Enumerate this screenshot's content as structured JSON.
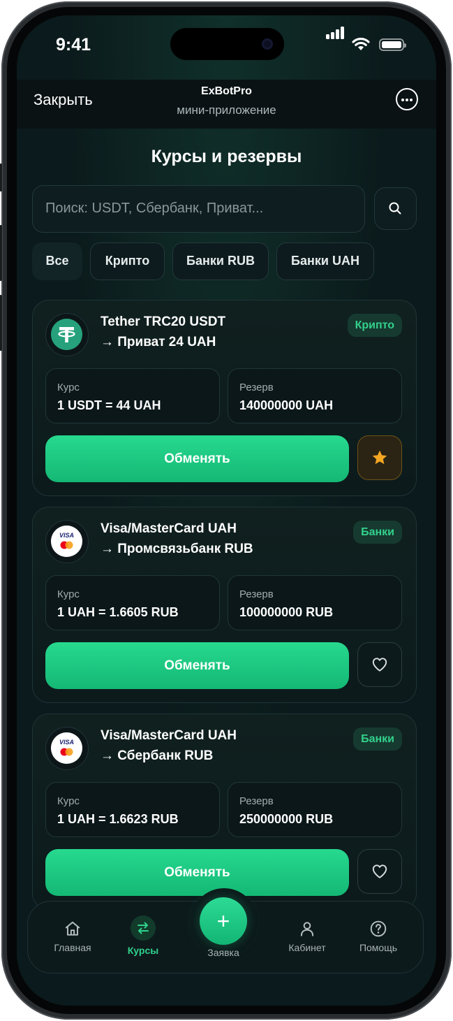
{
  "status_bar": {
    "time": "9:41"
  },
  "header": {
    "close_label": "Закрыть",
    "title": "ExBotPro",
    "subtitle": "мини-приложение"
  },
  "page_title": "Курсы и резервы",
  "search": {
    "placeholder": "Поиск: USDT, Сбербанк, Приват..."
  },
  "filters": [
    {
      "label": "Все",
      "active": true
    },
    {
      "label": "Крипто",
      "active": false
    },
    {
      "label": "Банки RUB",
      "active": false
    },
    {
      "label": "Банки UAH",
      "active": false
    }
  ],
  "cards": [
    {
      "from": "Tether TRC20 USDT",
      "to": "→ Приват 24 UAH",
      "tag": "Крипто",
      "rate_label": "Курс",
      "rate": "1 USDT = 44 UAH",
      "reserve_label": "Резерв",
      "reserve": "140000000 UAH",
      "button": "Обменять",
      "favorite": true,
      "logo": "tether-icon"
    },
    {
      "from": "Visa/MasterCard UAH",
      "to": "→ Промсвязьбанк RUB",
      "tag": "Банки",
      "rate_label": "Курс",
      "rate": "1 UAH = 1.6605 RUB",
      "reserve_label": "Резерв",
      "reserve": "100000000 RUB",
      "button": "Обменять",
      "favorite": false,
      "logo": "visa-mastercard-icon"
    },
    {
      "from": "Visa/MasterCard UAH",
      "to": "→ Сбербанк RUB",
      "tag": "Банки",
      "rate_label": "Курс",
      "rate": "1 UAH = 1.6623 RUB",
      "reserve_label": "Резерв",
      "reserve": "250000000 RUB",
      "button": "Обменять",
      "favorite": false,
      "logo": "visa-mastercard-icon"
    }
  ],
  "logo_text": {
    "visa": "VISA"
  },
  "nav": {
    "home": "Главная",
    "rates": "Курсы",
    "order": "Заявка",
    "cabinet": "Кабинет",
    "help": "Помощь",
    "active": "rates"
  },
  "colors": {
    "accent": "#22c982",
    "background": "#0b1a1c",
    "favorite": "#f5a623"
  }
}
